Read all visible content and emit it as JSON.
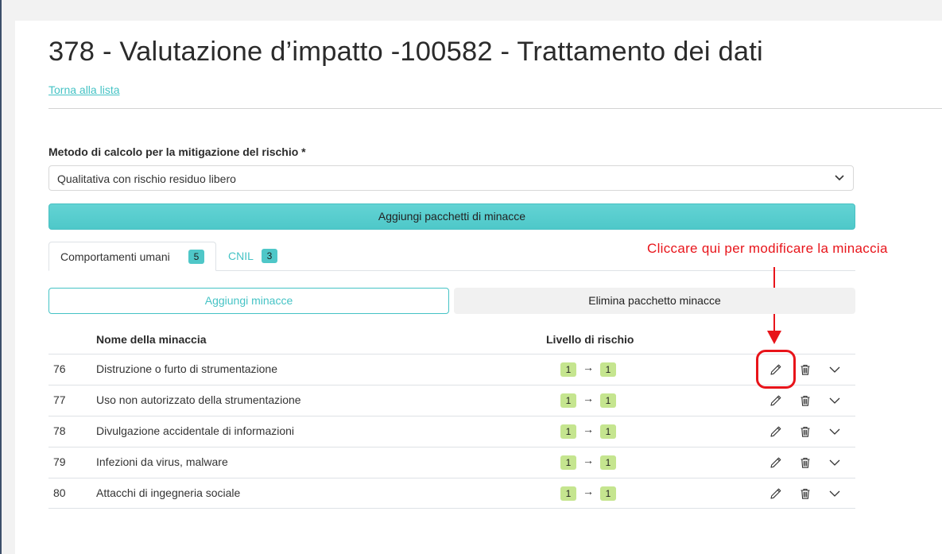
{
  "page": {
    "title": "378 - Valutazione d’impatto -100582 - Trattamento dei dati",
    "back_link": "Torna alla lista"
  },
  "method": {
    "label": "Metodo di calcolo per la mitigazione del rischio *",
    "value": "Qualitativa con rischio residuo libero"
  },
  "buttons": {
    "add_packages": "Aggiungi pacchetti di minacce",
    "add_threats": "Aggiungi minacce",
    "delete_package": "Elimina pacchetto minacce"
  },
  "tabs": [
    {
      "label": "Comportamenti umani",
      "count": "5",
      "active": true
    },
    {
      "label": "CNIL",
      "count": "3",
      "active": false
    }
  ],
  "annotation": "Cliccare qui per modificare la minaccia",
  "table": {
    "headers": {
      "name": "Nome della minaccia",
      "risk": "Livello di rischio"
    },
    "arrow": "→",
    "rows": [
      {
        "id": "76",
        "name": "Distruzione o furto di strumentazione",
        "risk_from": "1",
        "risk_to": "1"
      },
      {
        "id": "77",
        "name": "Uso non autorizzato della strumentazione",
        "risk_from": "1",
        "risk_to": "1"
      },
      {
        "id": "78",
        "name": "Divulgazione accidentale di informazioni",
        "risk_from": "1",
        "risk_to": "1"
      },
      {
        "id": "79",
        "name": "Infezioni da virus, malware",
        "risk_from": "1",
        "risk_to": "1"
      },
      {
        "id": "80",
        "name": "Attacchi di ingegneria sociale",
        "risk_from": "1",
        "risk_to": "1"
      }
    ]
  },
  "icons": {
    "edit": "pencil-icon",
    "delete": "trash-icon",
    "expand": "chevron-down-icon",
    "select": "chevron-down-icon"
  },
  "colors": {
    "accent": "#4ec8c9",
    "link": "#45c3c5",
    "risk_badge": "#c5e58f",
    "annotation": "#e8141a"
  }
}
